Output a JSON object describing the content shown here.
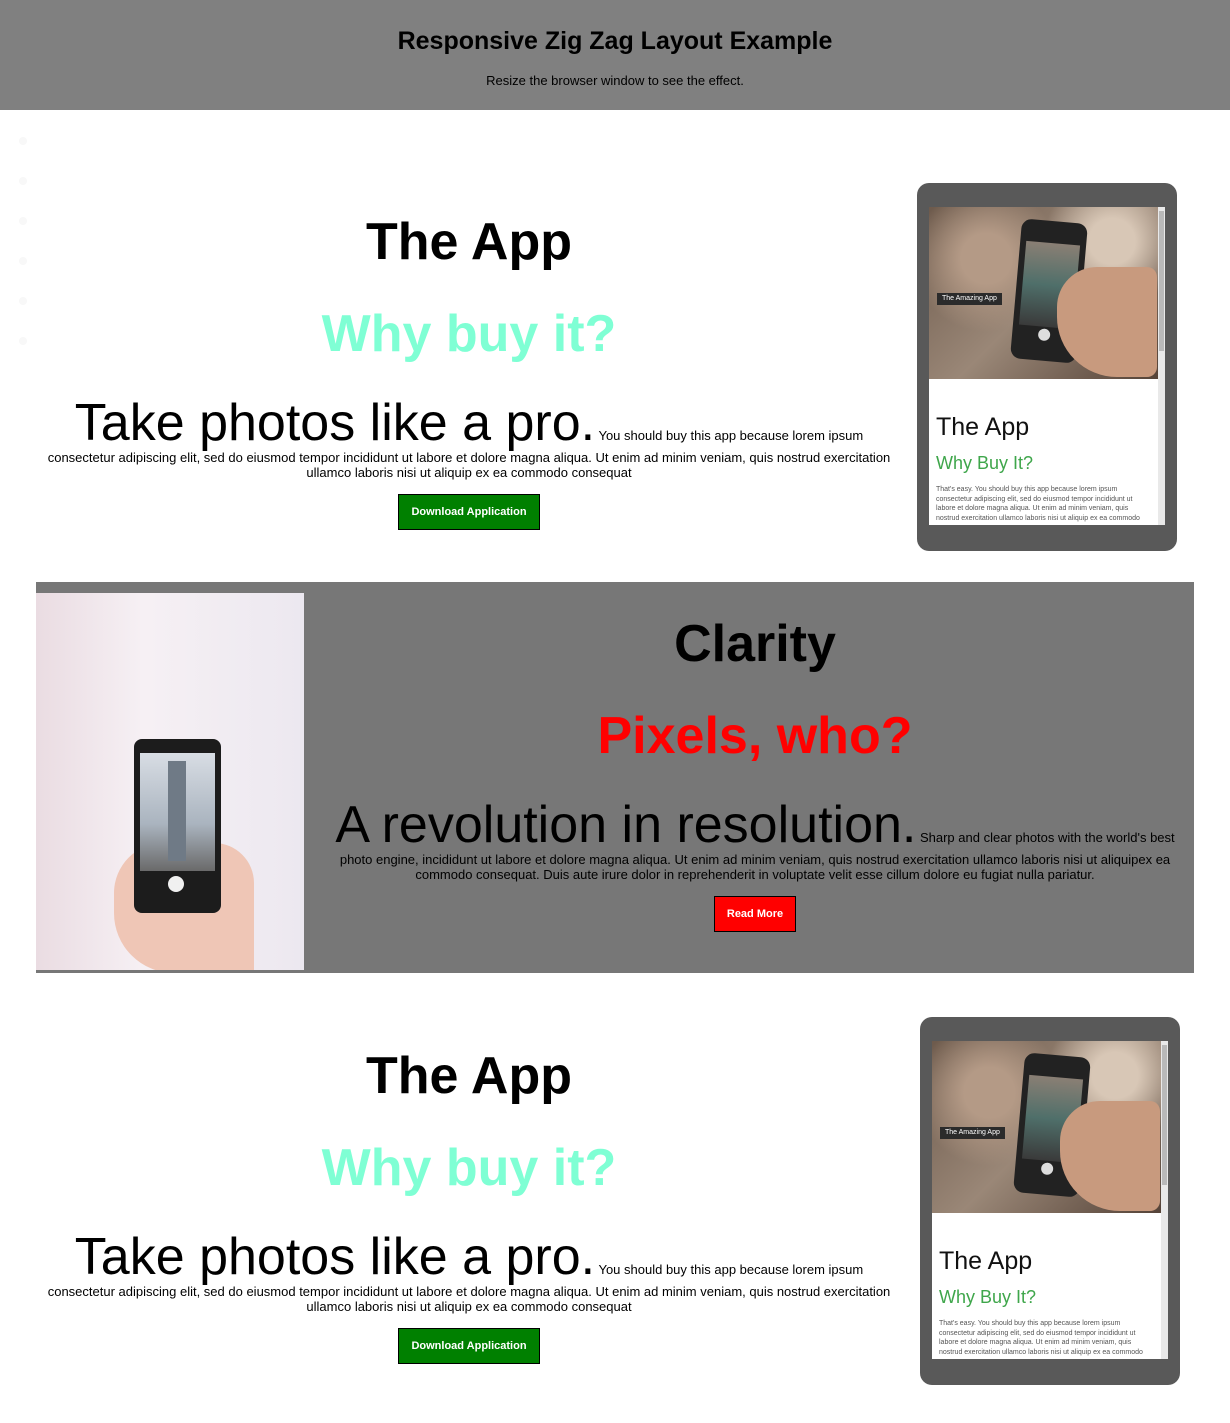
{
  "header": {
    "title": "Responsive Zig Zag Layout Example",
    "subtitle": "Resize the browser window to see the effect."
  },
  "sections": [
    {
      "title": "The App",
      "subtitle": "Why buy it?",
      "lead": "Take photos like a pro.",
      "body": " You should buy this app because lorem ipsum consectetur adipiscing elit, sed do eiusmod tempor incididunt ut labore et dolore magna aliqua. Ut enim ad minim veniam, quis nostrud exercitation ullamco laboris nisi ut aliquip ex ea commodo consequat",
      "button": "Download Application",
      "tablet": {
        "badge": "The Amazing App",
        "title": "The App",
        "subtitle": "Why Buy It?",
        "body": "That's easy. You should buy this app because lorem ipsum consectetur adipiscing elit, sed do eiusmod tempor incididunt ut labore et dolore magna aliqua. Ut enim ad minim veniam, quis nostrud exercitation ullamco laboris nisi ut aliquip ex ea commodo"
      }
    },
    {
      "title": "Clarity",
      "subtitle": "Pixels, who?",
      "lead": "A revolution in resolution.",
      "body": " Sharp and clear photos with the world's best photo engine, incididunt ut labore et dolore magna aliqua. Ut enim ad minim veniam, quis nostrud exercitation ullamco laboris nisi ut aliquipex ea commodo consequat. Duis aute irure dolor in reprehenderit in voluptate velit esse cillum dolore eu fugiat nulla pariatur.",
      "button": "Read More"
    },
    {
      "title": "The App",
      "subtitle": "Why buy it?",
      "lead": "Take photos like a pro.",
      "body": " You should buy this app because lorem ipsum consectetur adipiscing elit, sed do eiusmod tempor incididunt ut labore et dolore magna aliqua. Ut enim ad minim veniam, quis nostrud exercitation ullamco laboris nisi ut aliquip ex ea commodo consequat",
      "button": "Download Application",
      "tablet": {
        "badge": "The Amazing App",
        "title": "The App",
        "subtitle": "Why Buy It?",
        "body": "That's easy. You should buy this app because lorem ipsum consectetur adipiscing elit, sed do eiusmod tempor incididunt ut labore et dolore magna aliqua. Ut enim ad minim veniam, quis nostrud exercitation ullamco laboris nisi ut aliquip ex ea commodo"
      }
    }
  ],
  "colors": {
    "header_bg": "#808080",
    "section_alt_bg": "#777777",
    "accent_aquamarine": "#7fffd4",
    "accent_red": "#ff0000",
    "button_green": "#008000",
    "button_red": "#ff0000"
  }
}
